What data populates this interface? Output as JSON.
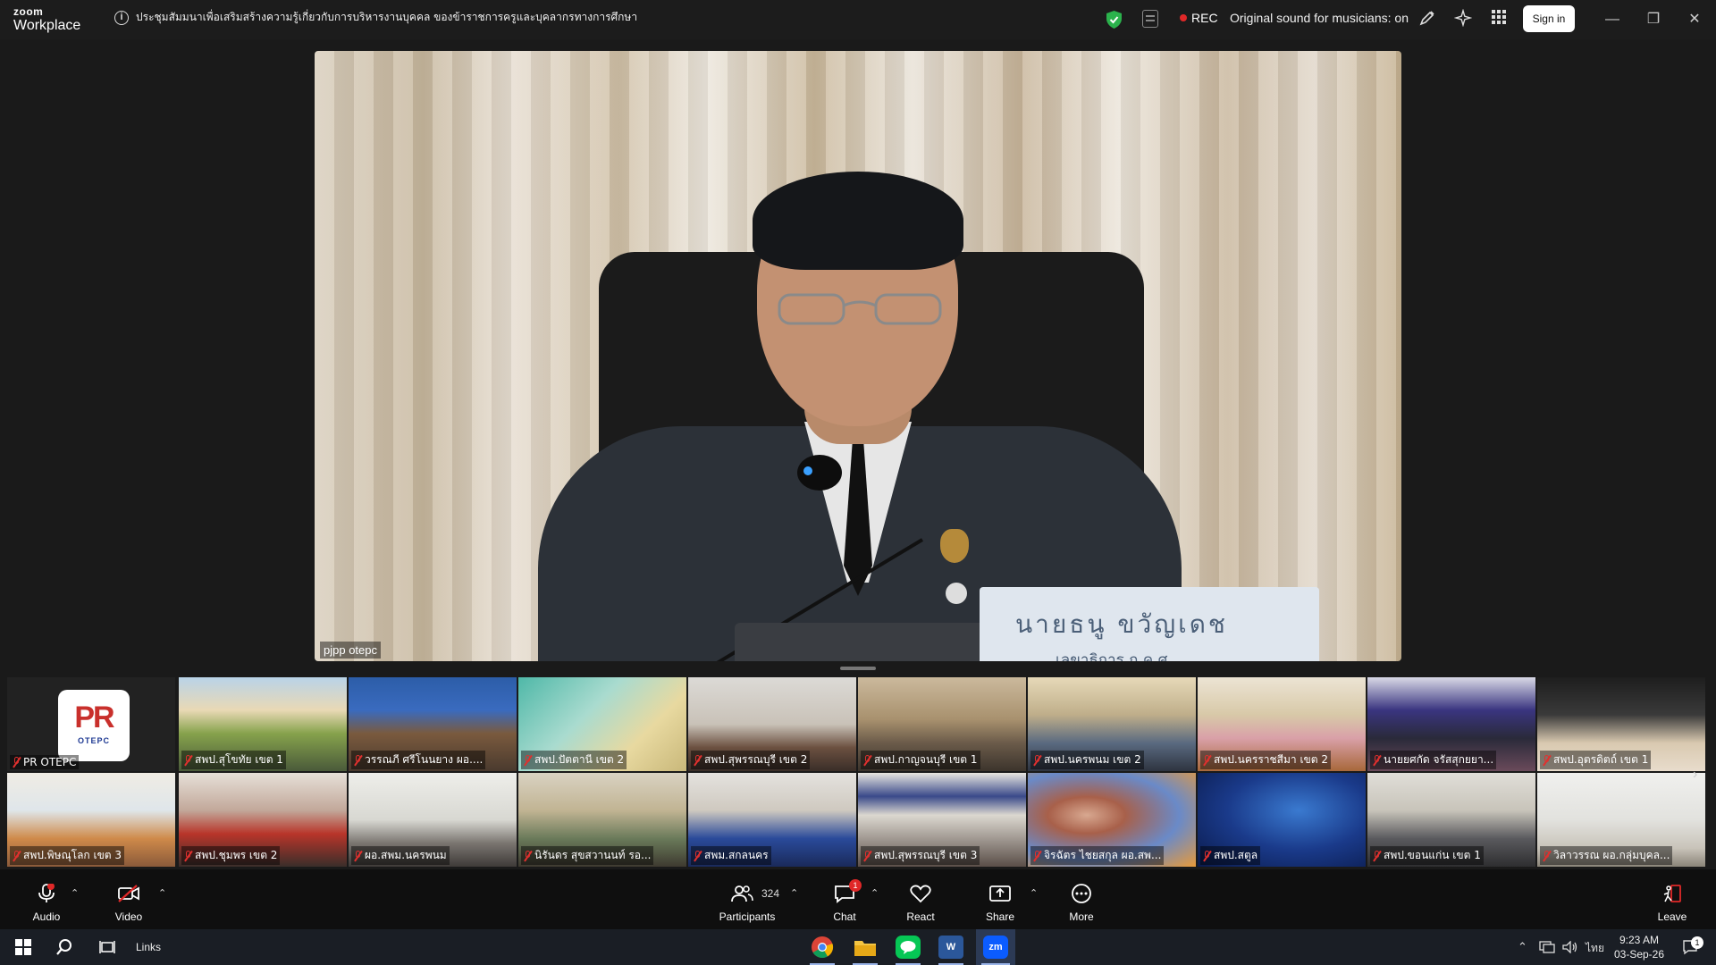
{
  "titlebar": {
    "brand_top": "zoom",
    "brand_bottom": "Workplace",
    "meeting_title": "ประชุมสัมมนาเพื่อเสริมสร้างความรู้เกี่ยวกับการบริหารงานบุคคล ของข้าราชการครูและบุคลากรทางการศึกษา",
    "rec_label": "REC",
    "original_sound": "Original sound for musicians: on",
    "signin_label": "Sign in",
    "encryption_color": "#2bb24c",
    "rec_color": "#e02828"
  },
  "main_video": {
    "participant_name": "pjpp otepc",
    "nameplate_name": "นายธนู  ขวัญเดช",
    "nameplate_title": "เลขาธิการ ก.ค.ศ."
  },
  "gallery": {
    "row1": [
      {
        "name": "PR OTEPC",
        "muted": true
      },
      {
        "name": "สพป.สุโขทัย เขต 1",
        "muted": true
      },
      {
        "name": "วรรณภี ศรีโนนยาง ผอ....",
        "muted": true
      },
      {
        "name": "สพป.ปัตตานี เขต 2",
        "muted": true
      },
      {
        "name": "สพป.สุพรรณบุรี เขต 2",
        "muted": true
      },
      {
        "name": "สพป.กาญจนบุรี เขต 1",
        "muted": true
      },
      {
        "name": "สพป.นครพนม เขต 2",
        "muted": true
      },
      {
        "name": "สพป.นครราชสีมา เขต 2",
        "muted": true
      },
      {
        "name": "นายยศกัด จรัสสุกยยา...",
        "muted": true
      },
      {
        "name": "สพป.อุตรดิตถ์ เขต 1",
        "muted": true
      }
    ],
    "row2": [
      {
        "name": "สพป.พิษณุโลก เขต 3",
        "muted": true
      },
      {
        "name": "สพป.ชุมพร เขต 2",
        "muted": true
      },
      {
        "name": "ผอ.สพม.นครพนม",
        "muted": true
      },
      {
        "name": "นิรันดร สุขสวานนท์ รอ...",
        "muted": true
      },
      {
        "name": "สพม.สกลนคร",
        "muted": true
      },
      {
        "name": "สพป.สุพรรณบุรี เขต 3",
        "muted": true
      },
      {
        "name": "จิรฉัตร ไชยสกุล ผอ.สพ...",
        "muted": true
      },
      {
        "name": "สพป.สตูล",
        "muted": true
      },
      {
        "name": "สพป.ขอนแก่น เขต 1",
        "muted": true
      },
      {
        "name": "วิลาวรรณ ผอ.กลุ่มบุคล...",
        "muted": true
      }
    ],
    "pr_logo_text": "PR",
    "pr_logo_sub": "OTEPC"
  },
  "toolbar": {
    "audio_label": "Audio",
    "video_label": "Video",
    "participants_label": "Participants",
    "participants_count": "324",
    "chat_label": "Chat",
    "chat_badge": "1",
    "react_label": "React",
    "share_label": "Share",
    "more_label": "More",
    "leave_label": "Leave",
    "leave_color": "#e02828"
  },
  "taskbar": {
    "links_label": "Links",
    "word_label": "W",
    "zoom_label": "zm",
    "lang": "ไทย",
    "time": "9:23 AM",
    "date": "03-Sep-26",
    "notification_count": "1"
  }
}
